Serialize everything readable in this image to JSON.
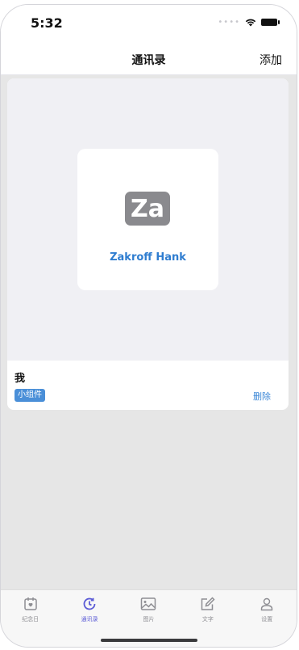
{
  "status": {
    "time": "5:32"
  },
  "nav": {
    "title": "通讯录",
    "action": "添加"
  },
  "contact": {
    "initials": "Za",
    "name": "Zakroff Hank"
  },
  "card": {
    "title": "我",
    "tag": "小组件",
    "delete": "删除"
  },
  "tabbar": {
    "items": [
      {
        "label": "纪念日",
        "icon": "calendar-icon",
        "active": false
      },
      {
        "label": "通讯录",
        "icon": "clock-icon",
        "active": true
      },
      {
        "label": "图片",
        "icon": "image-icon",
        "active": false
      },
      {
        "label": "文字",
        "icon": "edit-icon",
        "active": false
      },
      {
        "label": "设置",
        "icon": "person-icon",
        "active": false
      }
    ]
  },
  "colors": {
    "accent": "#5b5bd6",
    "link": "#2f7dd0",
    "tag": "#4a8fd8"
  }
}
